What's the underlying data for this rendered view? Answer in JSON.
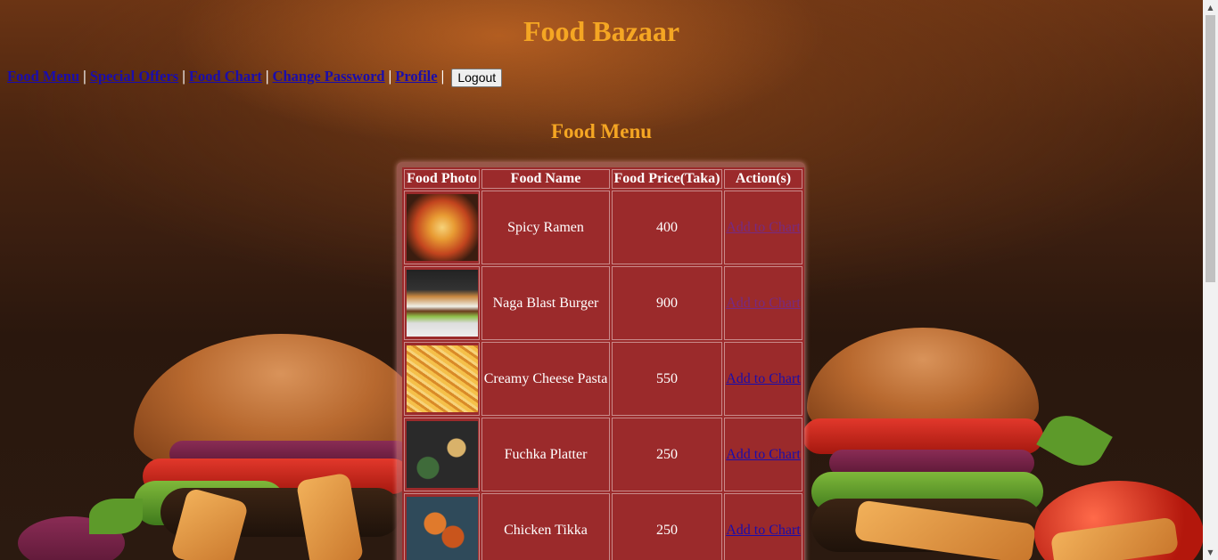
{
  "site_title": "Food Bazaar",
  "nav": {
    "links": [
      "Food Menu",
      "Special Offers",
      "Food Chart",
      "Change Password",
      "Profile"
    ],
    "separator": "|",
    "logout_label": "Logout"
  },
  "section_title": "Food Menu",
  "table": {
    "headers": [
      "Food Photo",
      "Food Name",
      "Food Price(Taka)",
      "Action(s)"
    ],
    "rows": [
      {
        "photo": "spicy-ramen-photo",
        "name": "Spicy Ramen",
        "price": "400",
        "action": "Add to Chart"
      },
      {
        "photo": "naga-blast-burger-photo",
        "name": "Naga Blast Burger",
        "price": "900",
        "action": "Add to Chart"
      },
      {
        "photo": "creamy-cheese-pasta-photo",
        "name": "Creamy Cheese Pasta",
        "price": "550",
        "action": "Add to Chart"
      },
      {
        "photo": "fuchka-platter-photo",
        "name": "Fuchka Platter",
        "price": "250",
        "action": "Add to Chart"
      },
      {
        "photo": "chicken-tikka-photo",
        "name": "Chicken Tikka",
        "price": "250",
        "action": "Add to Chart"
      }
    ]
  },
  "colors": {
    "title": "#f5a623",
    "table_bg": "#9b2a2b",
    "link": "#1a0dab"
  }
}
